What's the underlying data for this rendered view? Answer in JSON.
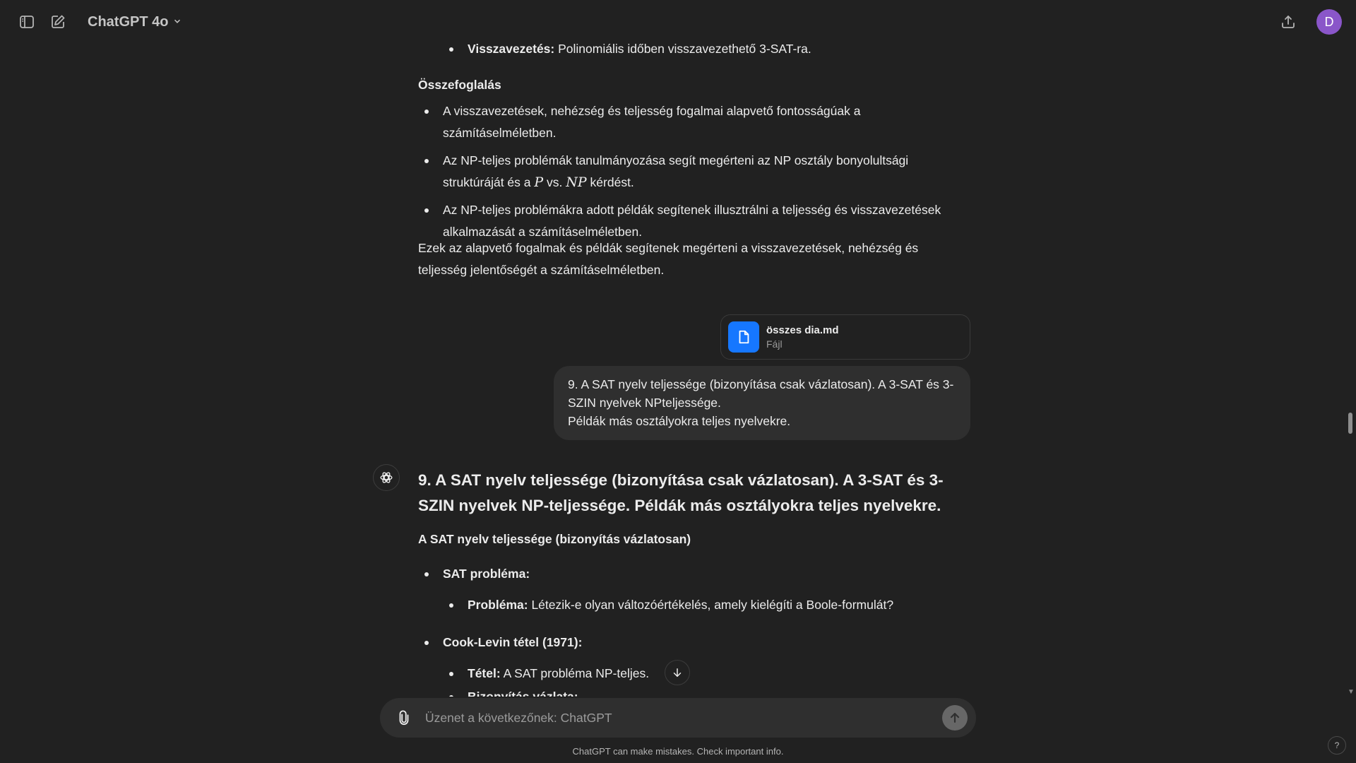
{
  "header": {
    "model_name": "ChatGPT 4o",
    "avatar_letter": "D",
    "icons": [
      "sidebar-toggle-icon",
      "new-chat-icon",
      "chevron-down-icon",
      "share-icon"
    ]
  },
  "previous_answer": {
    "top_bullet_bold": "Visszavezetés:",
    "top_bullet_text": " Polinomiális időben visszavezethető 3-SAT-ra.",
    "summary_heading": "Összefoglalás",
    "summary_items": [
      "A visszavezetések, nehézség és teljesség fogalmai alapvető fontosságúak a számításelméletben.",
      "Az NP-teljes problémák tanulmányozása segít megérteni az NP osztály bonyolultsági struktúráját és a ",
      "Az NP-teljes problémákra adott példák segítenek illusztrálni a teljesség és visszavezetések alkalmazását a számításelméletben."
    ],
    "math_p": "P",
    "math_vs": " vs. ",
    "math_np": "NP",
    "math_tail": " kérdést.",
    "closing": "Ezek az alapvető fogalmak és példák segítenek megérteni a visszavezetések, nehézség és teljesség jelentőségét a számításelméletben."
  },
  "attachment": {
    "name": "összes dia.md",
    "type": "Fájl"
  },
  "user_message": {
    "line1": "9. A SAT nyelv teljessége (bizonyítása csak vázlatosan). A 3-SAT és 3-SZIN nyelvek NPteljessége.",
    "line2": "Példák más osztályokra teljes nyelvekre."
  },
  "assistant": {
    "heading": "9. A SAT nyelv teljessége (bizonyítása csak vázlatosan). A 3-SAT és 3-SZIN nyelvek NP-teljessége. Példák más osztályokra teljes nyelvekre.",
    "subheading": "A SAT nyelv teljessége (bizonyítás vázlatosan)",
    "sat_label": "SAT probléma:",
    "problem_bold": "Probléma:",
    "problem_text": " Létezik-e olyan változóértékelés, amely kielégíti a Boole-formulát?",
    "cook_label": "Cook-Levin tétel (1971):",
    "theorem_bold": "Tétel:",
    "theorem_text": " A SAT probléma NP-teljes.",
    "partial_next": "Bizonyítás vázlata:"
  },
  "composer": {
    "placeholder": "Üzenet a következőnek: ChatGPT"
  },
  "footer": {
    "disclaimer": "ChatGPT can make mistakes. Check important info.",
    "help": "?"
  }
}
